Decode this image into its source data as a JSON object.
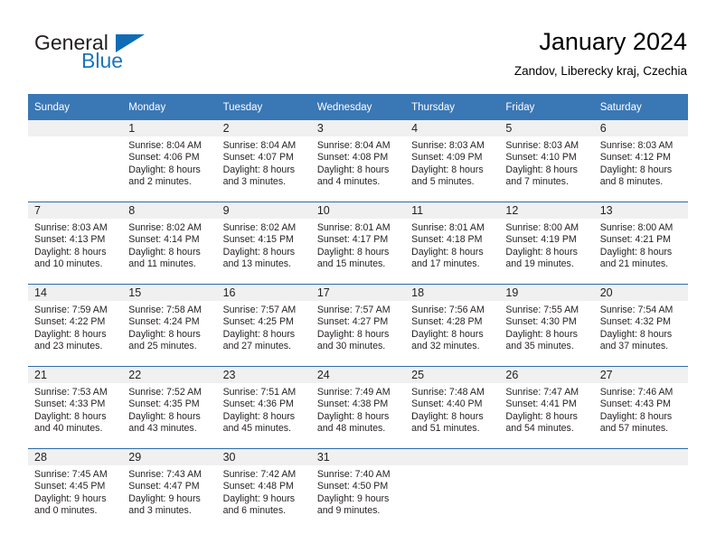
{
  "brand": {
    "name_top": "General",
    "name_bottom": "Blue",
    "accent_color": "#1b75bb",
    "triangle_color": "#0f6cb5"
  },
  "header": {
    "title": "January 2024",
    "subtitle": "Zandov, Liberecky kraj, Czechia"
  },
  "theme": {
    "header_row_bg": "#3a77b5",
    "day_band_bg": "#f0f0f0",
    "row_divider": "#2d6ca8",
    "text": "#231f20"
  },
  "weekday_headers": [
    "Sunday",
    "Monday",
    "Tuesday",
    "Wednesday",
    "Thursday",
    "Friday",
    "Saturday"
  ],
  "weeks": [
    {
      "days": [
        {
          "num": "",
          "empty": true,
          "sunrise": "",
          "sunset": "",
          "daylight1": "",
          "daylight2": ""
        },
        {
          "num": "1",
          "empty": false,
          "sunrise": "Sunrise: 8:04 AM",
          "sunset": "Sunset: 4:06 PM",
          "daylight1": "Daylight: 8 hours",
          "daylight2": "and 2 minutes."
        },
        {
          "num": "2",
          "empty": false,
          "sunrise": "Sunrise: 8:04 AM",
          "sunset": "Sunset: 4:07 PM",
          "daylight1": "Daylight: 8 hours",
          "daylight2": "and 3 minutes."
        },
        {
          "num": "3",
          "empty": false,
          "sunrise": "Sunrise: 8:04 AM",
          "sunset": "Sunset: 4:08 PM",
          "daylight1": "Daylight: 8 hours",
          "daylight2": "and 4 minutes."
        },
        {
          "num": "4",
          "empty": false,
          "sunrise": "Sunrise: 8:03 AM",
          "sunset": "Sunset: 4:09 PM",
          "daylight1": "Daylight: 8 hours",
          "daylight2": "and 5 minutes."
        },
        {
          "num": "5",
          "empty": false,
          "sunrise": "Sunrise: 8:03 AM",
          "sunset": "Sunset: 4:10 PM",
          "daylight1": "Daylight: 8 hours",
          "daylight2": "and 7 minutes."
        },
        {
          "num": "6",
          "empty": false,
          "sunrise": "Sunrise: 8:03 AM",
          "sunset": "Sunset: 4:12 PM",
          "daylight1": "Daylight: 8 hours",
          "daylight2": "and 8 minutes."
        }
      ]
    },
    {
      "days": [
        {
          "num": "7",
          "empty": false,
          "sunrise": "Sunrise: 8:03 AM",
          "sunset": "Sunset: 4:13 PM",
          "daylight1": "Daylight: 8 hours",
          "daylight2": "and 10 minutes."
        },
        {
          "num": "8",
          "empty": false,
          "sunrise": "Sunrise: 8:02 AM",
          "sunset": "Sunset: 4:14 PM",
          "daylight1": "Daylight: 8 hours",
          "daylight2": "and 11 minutes."
        },
        {
          "num": "9",
          "empty": false,
          "sunrise": "Sunrise: 8:02 AM",
          "sunset": "Sunset: 4:15 PM",
          "daylight1": "Daylight: 8 hours",
          "daylight2": "and 13 minutes."
        },
        {
          "num": "10",
          "empty": false,
          "sunrise": "Sunrise: 8:01 AM",
          "sunset": "Sunset: 4:17 PM",
          "daylight1": "Daylight: 8 hours",
          "daylight2": "and 15 minutes."
        },
        {
          "num": "11",
          "empty": false,
          "sunrise": "Sunrise: 8:01 AM",
          "sunset": "Sunset: 4:18 PM",
          "daylight1": "Daylight: 8 hours",
          "daylight2": "and 17 minutes."
        },
        {
          "num": "12",
          "empty": false,
          "sunrise": "Sunrise: 8:00 AM",
          "sunset": "Sunset: 4:19 PM",
          "daylight1": "Daylight: 8 hours",
          "daylight2": "and 19 minutes."
        },
        {
          "num": "13",
          "empty": false,
          "sunrise": "Sunrise: 8:00 AM",
          "sunset": "Sunset: 4:21 PM",
          "daylight1": "Daylight: 8 hours",
          "daylight2": "and 21 minutes."
        }
      ]
    },
    {
      "days": [
        {
          "num": "14",
          "empty": false,
          "sunrise": "Sunrise: 7:59 AM",
          "sunset": "Sunset: 4:22 PM",
          "daylight1": "Daylight: 8 hours",
          "daylight2": "and 23 minutes."
        },
        {
          "num": "15",
          "empty": false,
          "sunrise": "Sunrise: 7:58 AM",
          "sunset": "Sunset: 4:24 PM",
          "daylight1": "Daylight: 8 hours",
          "daylight2": "and 25 minutes."
        },
        {
          "num": "16",
          "empty": false,
          "sunrise": "Sunrise: 7:57 AM",
          "sunset": "Sunset: 4:25 PM",
          "daylight1": "Daylight: 8 hours",
          "daylight2": "and 27 minutes."
        },
        {
          "num": "17",
          "empty": false,
          "sunrise": "Sunrise: 7:57 AM",
          "sunset": "Sunset: 4:27 PM",
          "daylight1": "Daylight: 8 hours",
          "daylight2": "and 30 minutes."
        },
        {
          "num": "18",
          "empty": false,
          "sunrise": "Sunrise: 7:56 AM",
          "sunset": "Sunset: 4:28 PM",
          "daylight1": "Daylight: 8 hours",
          "daylight2": "and 32 minutes."
        },
        {
          "num": "19",
          "empty": false,
          "sunrise": "Sunrise: 7:55 AM",
          "sunset": "Sunset: 4:30 PM",
          "daylight1": "Daylight: 8 hours",
          "daylight2": "and 35 minutes."
        },
        {
          "num": "20",
          "empty": false,
          "sunrise": "Sunrise: 7:54 AM",
          "sunset": "Sunset: 4:32 PM",
          "daylight1": "Daylight: 8 hours",
          "daylight2": "and 37 minutes."
        }
      ]
    },
    {
      "days": [
        {
          "num": "21",
          "empty": false,
          "sunrise": "Sunrise: 7:53 AM",
          "sunset": "Sunset: 4:33 PM",
          "daylight1": "Daylight: 8 hours",
          "daylight2": "and 40 minutes."
        },
        {
          "num": "22",
          "empty": false,
          "sunrise": "Sunrise: 7:52 AM",
          "sunset": "Sunset: 4:35 PM",
          "daylight1": "Daylight: 8 hours",
          "daylight2": "and 43 minutes."
        },
        {
          "num": "23",
          "empty": false,
          "sunrise": "Sunrise: 7:51 AM",
          "sunset": "Sunset: 4:36 PM",
          "daylight1": "Daylight: 8 hours",
          "daylight2": "and 45 minutes."
        },
        {
          "num": "24",
          "empty": false,
          "sunrise": "Sunrise: 7:49 AM",
          "sunset": "Sunset: 4:38 PM",
          "daylight1": "Daylight: 8 hours",
          "daylight2": "and 48 minutes."
        },
        {
          "num": "25",
          "empty": false,
          "sunrise": "Sunrise: 7:48 AM",
          "sunset": "Sunset: 4:40 PM",
          "daylight1": "Daylight: 8 hours",
          "daylight2": "and 51 minutes."
        },
        {
          "num": "26",
          "empty": false,
          "sunrise": "Sunrise: 7:47 AM",
          "sunset": "Sunset: 4:41 PM",
          "daylight1": "Daylight: 8 hours",
          "daylight2": "and 54 minutes."
        },
        {
          "num": "27",
          "empty": false,
          "sunrise": "Sunrise: 7:46 AM",
          "sunset": "Sunset: 4:43 PM",
          "daylight1": "Daylight: 8 hours",
          "daylight2": "and 57 minutes."
        }
      ]
    },
    {
      "days": [
        {
          "num": "28",
          "empty": false,
          "sunrise": "Sunrise: 7:45 AM",
          "sunset": "Sunset: 4:45 PM",
          "daylight1": "Daylight: 9 hours",
          "daylight2": "and 0 minutes."
        },
        {
          "num": "29",
          "empty": false,
          "sunrise": "Sunrise: 7:43 AM",
          "sunset": "Sunset: 4:47 PM",
          "daylight1": "Daylight: 9 hours",
          "daylight2": "and 3 minutes."
        },
        {
          "num": "30",
          "empty": false,
          "sunrise": "Sunrise: 7:42 AM",
          "sunset": "Sunset: 4:48 PM",
          "daylight1": "Daylight: 9 hours",
          "daylight2": "and 6 minutes."
        },
        {
          "num": "31",
          "empty": false,
          "sunrise": "Sunrise: 7:40 AM",
          "sunset": "Sunset: 4:50 PM",
          "daylight1": "Daylight: 9 hours",
          "daylight2": "and 9 minutes."
        },
        {
          "num": "",
          "empty": true,
          "sunrise": "",
          "sunset": "",
          "daylight1": "",
          "daylight2": ""
        },
        {
          "num": "",
          "empty": true,
          "sunrise": "",
          "sunset": "",
          "daylight1": "",
          "daylight2": ""
        },
        {
          "num": "",
          "empty": true,
          "sunrise": "",
          "sunset": "",
          "daylight1": "",
          "daylight2": ""
        }
      ]
    }
  ]
}
